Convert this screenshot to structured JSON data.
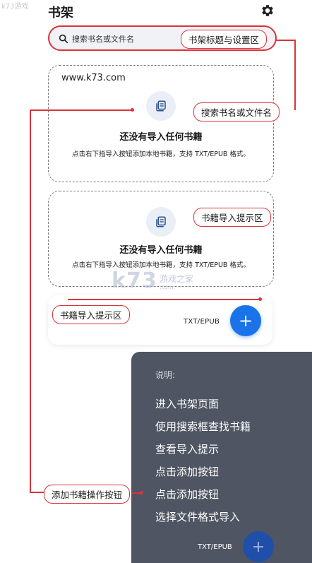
{
  "header": {
    "title": "书架",
    "watermark": "k73游戏"
  },
  "search": {
    "placeholder": "搜索书名或文件名"
  },
  "cards": [
    {
      "url": "www.k73.com",
      "title": "还没有导入任何书籍",
      "desc": "点击右下指导入按钮添加本地书籍，支持 TXT/EPUB 格式。"
    },
    {
      "title": "还没有导入任何书籍",
      "desc": "点击右下指导入按钮添加本地书籍，支持 TXT/EPUB 格式。"
    }
  ],
  "import_bar": {
    "format_label": "TXT/EPUB",
    "fab_label": "+"
  },
  "annotations": {
    "header_area": "书架标题与设置区",
    "search": "搜索书名或文件名",
    "import_hint_1": "书籍导入提示区",
    "import_hint_2": "书籍导入提示区",
    "add_button": "添加书籍操作按钮"
  },
  "watermark": {
    "logo": "k73",
    "sub": "游戏之家",
    "sub2": ".com"
  },
  "panel": {
    "heading": "说明:",
    "items": [
      "进入书架页面",
      "使用搜索框查找书籍",
      "查看导入提示",
      "点击添加按钮",
      "点击添加按钮",
      "选择文件格式导入"
    ],
    "format_label": "TXT/EPUB",
    "fab_label": "+"
  },
  "colors": {
    "accent_red": "#d8343a",
    "fab_blue": "#1a73e8",
    "panel_bg": "#4f5562"
  },
  "icons": [
    "gear-icon",
    "search-icon",
    "book-icon",
    "plus-icon"
  ]
}
